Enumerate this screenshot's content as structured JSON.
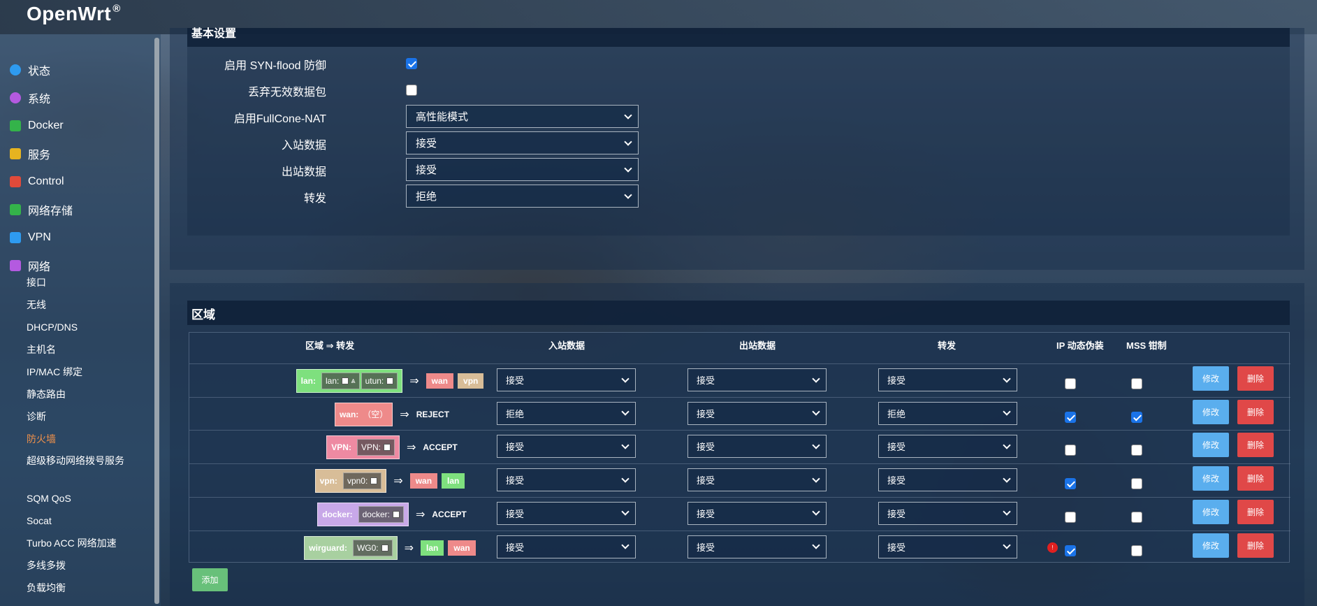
{
  "app": {
    "brand": "OpenWrt",
    "brand_mark": "®"
  },
  "sidebar": {
    "top_items": [
      {
        "label": "状态",
        "icon": "home-icon",
        "color": "#2e9bf0"
      },
      {
        "label": "系统",
        "icon": "gear-icon",
        "color": "#b45ae0"
      },
      {
        "label": "Docker",
        "icon": "grid-icon",
        "color": "#34b34a"
      },
      {
        "label": "服务",
        "icon": "service-icon",
        "color": "#e6b320"
      },
      {
        "label": "Control",
        "icon": "calendar-icon",
        "color": "#e04a3a"
      },
      {
        "label": "网络存储",
        "icon": "storage-icon",
        "color": "#34b34a"
      },
      {
        "label": "VPN",
        "icon": "vpn-icon",
        "color": "#2e9bf0"
      },
      {
        "label": "网络",
        "icon": "network-icon",
        "color": "#b45ae0"
      }
    ],
    "sub_items": [
      {
        "label": "接口"
      },
      {
        "label": "无线"
      },
      {
        "label": "DHCP/DNS"
      },
      {
        "label": "主机名"
      },
      {
        "label": "IP/MAC 绑定"
      },
      {
        "label": "静态路由"
      },
      {
        "label": "诊断"
      },
      {
        "label": "防火墙",
        "active": true
      },
      {
        "label": "超级移动网络拨号服务"
      },
      {
        "label": "SQM QoS"
      },
      {
        "label": "Socat"
      },
      {
        "label": "Turbo ACC 网络加速"
      },
      {
        "label": "多线多拨"
      },
      {
        "label": "负载均衡"
      }
    ]
  },
  "general": {
    "section_title": "基本设置",
    "syn_flood": {
      "label": "启用 SYN-flood 防御",
      "checked": true
    },
    "drop_invalid": {
      "label": "丢弃无效数据包",
      "checked": false
    },
    "fullcone": {
      "label": "启用FullCone-NAT",
      "value": "高性能模式"
    },
    "input": {
      "label": "入站数据",
      "value": "接受"
    },
    "output": {
      "label": "出站数据",
      "value": "接受"
    },
    "forward": {
      "label": "转发",
      "value": "拒绝"
    }
  },
  "zones": {
    "section_title": "区域",
    "headers": {
      "zone": "区域 ⇒ 转发",
      "input": "入站数据",
      "output": "出站数据",
      "forward": "转发",
      "masq": "IP 动态伪装",
      "mss": "MSS 钳制"
    },
    "rows": [
      {
        "name": "lan:",
        "color": "#7ee07e",
        "interfaces": [
          {
            "label": "lan:",
            "wifi": true
          },
          {
            "label": "utun:",
            "wifi": false
          }
        ],
        "targets": [
          {
            "label": "wan",
            "color": "#ee8a8a"
          },
          {
            "label": "vpn",
            "color": "#d8bd98"
          }
        ],
        "policy": "",
        "input": "接受",
        "output": "接受",
        "forward": "接受",
        "masq": false,
        "mss": false,
        "warn": false
      },
      {
        "name": "wan:",
        "color": "#ee8a8a",
        "interfaces": [],
        "empty_label": "（空）",
        "targets": [],
        "policy": "REJECT",
        "input": "拒绝",
        "output": "接受",
        "forward": "拒绝",
        "masq": true,
        "mss": true,
        "warn": false
      },
      {
        "name": "VPN:",
        "color": "#ee8aa2",
        "interfaces": [
          {
            "label": "VPN:",
            "wifi": false
          }
        ],
        "targets": [],
        "policy": "ACCEPT",
        "input": "接受",
        "output": "接受",
        "forward": "接受",
        "masq": false,
        "mss": false,
        "warn": false
      },
      {
        "name": "vpn:",
        "color": "#d8bd98",
        "interfaces": [
          {
            "label": "vpn0:",
            "wifi": false
          }
        ],
        "targets": [
          {
            "label": "wan",
            "color": "#ee8a8a"
          },
          {
            "label": "lan",
            "color": "#7ee07e"
          }
        ],
        "policy": "",
        "input": "接受",
        "output": "接受",
        "forward": "接受",
        "masq": true,
        "mss": false,
        "warn": false
      },
      {
        "name": "docker:",
        "color": "#c8a8e8",
        "interfaces": [
          {
            "label": "docker:",
            "wifi": false
          }
        ],
        "targets": [],
        "policy": "ACCEPT",
        "input": "接受",
        "output": "接受",
        "forward": "接受",
        "masq": false,
        "mss": false,
        "warn": false
      },
      {
        "name": "wirguard:",
        "color": "#a8d0a0",
        "interfaces": [
          {
            "label": "WG0:",
            "wifi": false
          }
        ],
        "targets": [
          {
            "label": "lan",
            "color": "#7ee07e"
          },
          {
            "label": "wan",
            "color": "#ee8a8a"
          }
        ],
        "policy": "",
        "input": "接受",
        "output": "接受",
        "forward": "接受",
        "masq": true,
        "mss": false,
        "warn": true,
        "warn_label": "!"
      }
    ],
    "edit_label": "修改",
    "delete_label": "删除",
    "add_label": "添加"
  }
}
